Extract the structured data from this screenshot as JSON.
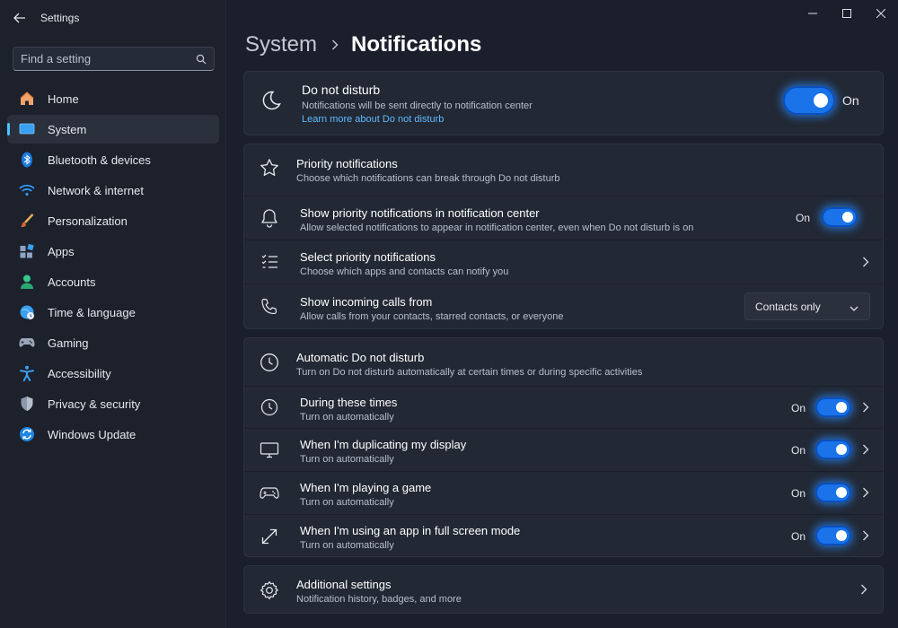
{
  "app": {
    "title": "Settings"
  },
  "search": {
    "placeholder": "Find a setting"
  },
  "nav": {
    "items": [
      {
        "label": "Home",
        "icon": "home-icon"
      },
      {
        "label": "System",
        "icon": "system-icon",
        "active": true
      },
      {
        "label": "Bluetooth & devices",
        "icon": "bluetooth-icon"
      },
      {
        "label": "Network & internet",
        "icon": "wifi-icon"
      },
      {
        "label": "Personalization",
        "icon": "brush-icon"
      },
      {
        "label": "Apps",
        "icon": "apps-icon"
      },
      {
        "label": "Accounts",
        "icon": "account-icon"
      },
      {
        "label": "Time & language",
        "icon": "globe-clock-icon"
      },
      {
        "label": "Gaming",
        "icon": "gamepad-icon"
      },
      {
        "label": "Accessibility",
        "icon": "accessibility-icon"
      },
      {
        "label": "Privacy & security",
        "icon": "shield-icon"
      },
      {
        "label": "Windows Update",
        "icon": "update-icon"
      }
    ]
  },
  "breadcrumb": {
    "parent": "System",
    "current": "Notifications"
  },
  "dnd": {
    "title": "Do not disturb",
    "subtitle": "Notifications will be sent directly to notification center",
    "link": "Learn more about Do not disturb",
    "state": "On"
  },
  "priority": {
    "header_title": "Priority notifications",
    "header_sub": "Choose which notifications can break through Do not disturb",
    "show_title": "Show priority notifications in notification center",
    "show_sub": "Allow selected notifications to appear in notification center, even when Do not disturb is on",
    "show_state": "On",
    "select_title": "Select priority notifications",
    "select_sub": "Choose which apps and contacts can notify you",
    "calls_title": "Show incoming calls from",
    "calls_sub": "Allow calls from your contacts, starred contacts, or everyone",
    "calls_value": "Contacts only"
  },
  "auto": {
    "header_title": "Automatic Do not disturb",
    "header_sub": "Turn on Do not disturb automatically at certain times or during specific activities",
    "rows": [
      {
        "title": "During these times",
        "sub": "Turn on automatically",
        "state": "On"
      },
      {
        "title": "When I'm duplicating my display",
        "sub": "Turn on automatically",
        "state": "On"
      },
      {
        "title": "When I'm playing a game",
        "sub": "Turn on automatically",
        "state": "On"
      },
      {
        "title": "When I'm using an app in full screen mode",
        "sub": "Turn on automatically",
        "state": "On"
      }
    ]
  },
  "additional": {
    "title": "Additional settings",
    "sub": "Notification history, badges, and more"
  },
  "colors": {
    "accent": "#4cc2ff",
    "toggle_on": "#1a73e8",
    "background": "#1a1f2b",
    "card": "#222834"
  }
}
